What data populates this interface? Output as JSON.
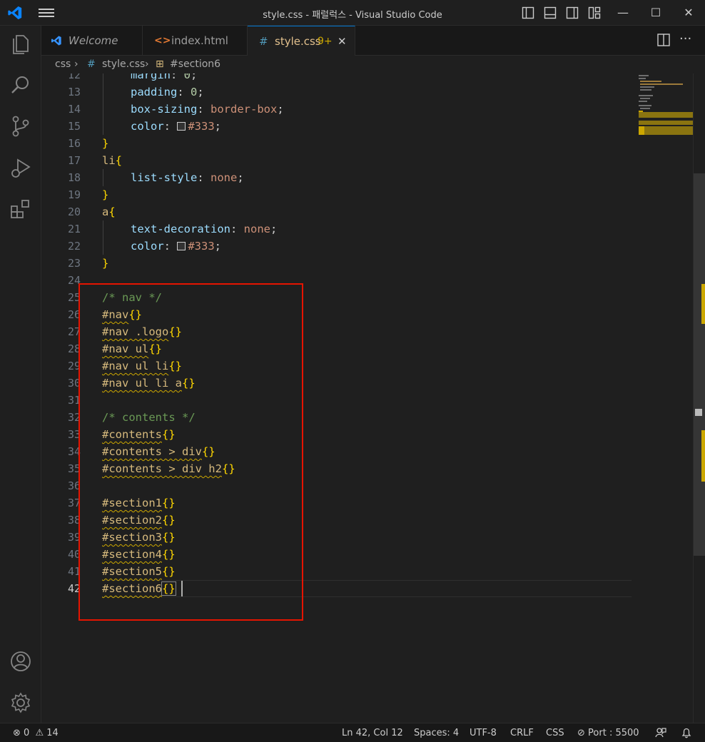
{
  "window": {
    "title": "style.css - 패럴럭스 - Visual Studio Code",
    "minimize": "—",
    "maximize": "☐",
    "close": "✕"
  },
  "tabs": [
    {
      "label": "Welcome",
      "icon": "vscode-logo-icon",
      "active": false
    },
    {
      "label": "index.html",
      "icon": "html-code-icon",
      "active": false
    },
    {
      "label": "style.css",
      "badge": "9+",
      "icon": "css-hash-icon",
      "active": true
    }
  ],
  "breadcrumbs": {
    "folder": "css",
    "file": "style.css",
    "symbol": "#section6"
  },
  "editor": {
    "line_numbers": [
      "12",
      "13",
      "14",
      "15",
      "16",
      "17",
      "18",
      "19",
      "20",
      "21",
      "22",
      "23",
      "24",
      "25",
      "26",
      "27",
      "28",
      "29",
      "30",
      "31",
      "32",
      "33",
      "34",
      "35",
      "36",
      "37",
      "38",
      "39",
      "40",
      "41",
      "42"
    ],
    "current_line": "42",
    "code": {
      "l12": {
        "prop": "margin",
        "colon": ": ",
        "val": "0",
        "semi": ";"
      },
      "l13": {
        "prop": "padding",
        "colon": ": ",
        "val": "0",
        "semi": ";"
      },
      "l14": {
        "prop": "box-sizing",
        "colon": ": ",
        "val": "border-box",
        "semi": ";"
      },
      "l15": {
        "prop": "color",
        "colon": ": ",
        "val": "#333",
        "semi": ";"
      },
      "l16": {
        "brace": "}"
      },
      "l17": {
        "sel": "li",
        "brace": "{"
      },
      "l18": {
        "prop": "list-style",
        "colon": ": ",
        "val": "none",
        "semi": ";"
      },
      "l19": {
        "brace": "}"
      },
      "l20": {
        "sel": "a",
        "brace": "{"
      },
      "l21": {
        "prop": "text-decoration",
        "colon": ": ",
        "val": "none",
        "semi": ";"
      },
      "l22": {
        "prop": "color",
        "colon": ": ",
        "val": "#333",
        "semi": ";"
      },
      "l23": {
        "brace": "}"
      },
      "l25": {
        "comment": "/* nav */"
      },
      "l26": {
        "sel": "#nav",
        "brace": "{}"
      },
      "l27": {
        "sel": "#nav .logo",
        "brace": "{}"
      },
      "l28": {
        "sel": "#nav ul",
        "brace": "{}"
      },
      "l29": {
        "sel": "#nav ul li",
        "brace": "{}"
      },
      "l30": {
        "sel": "#nav ul li a",
        "brace": "{}"
      },
      "l32": {
        "comment": "/* contents */"
      },
      "l33": {
        "sel": "#contents",
        "brace": "{}"
      },
      "l34": {
        "sel": "#contents > div",
        "brace": "{}"
      },
      "l35": {
        "sel": "#contents > div h2",
        "brace": "{}"
      },
      "l37": {
        "sel": "#section1",
        "brace": "{}"
      },
      "l38": {
        "sel": "#section2",
        "brace": "{}"
      },
      "l39": {
        "sel": "#section3",
        "brace": "{}"
      },
      "l40": {
        "sel": "#section4",
        "brace": "{}"
      },
      "l41": {
        "sel": "#section5",
        "brace": "{}"
      },
      "l42": {
        "sel": "#section6",
        "brace": "{}"
      }
    }
  },
  "statusbar": {
    "errors": "0",
    "warnings": "14",
    "position": "Ln 42, Col 12",
    "spaces": "Spaces: 4",
    "encoding": "UTF-8",
    "eol": "CRLF",
    "language": "CSS",
    "port": "Port : 5500"
  },
  "colors": {
    "accent": "#0078d4",
    "highlight_box": "#e51400",
    "warning_squiggle": "#cca700"
  }
}
